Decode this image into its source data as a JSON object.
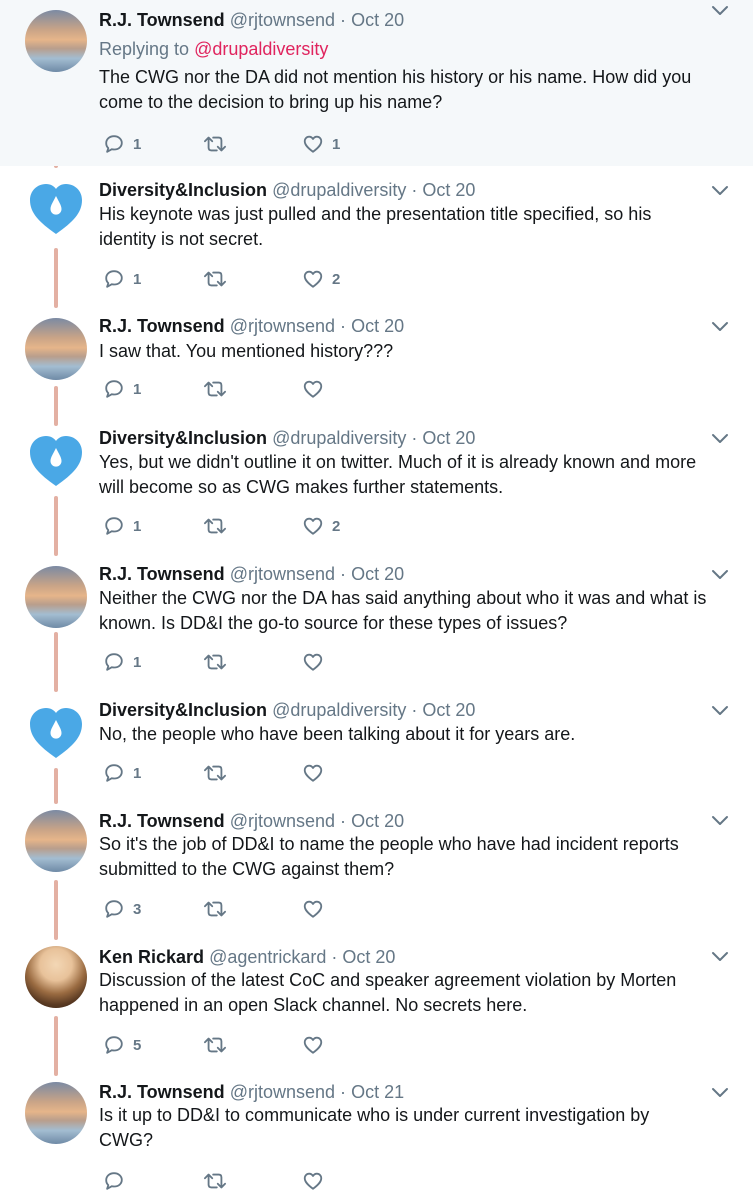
{
  "replying_to": {
    "prefix": "Replying to",
    "mention": "@drupaldiversity"
  },
  "tweets": [
    {
      "name": "R.J. Townsend",
      "handle": "@rjtownsend",
      "sep": "·",
      "time": "Oct 20",
      "lines": [
        "The CWG nor the DA did not mention his history or his name. How did you",
        "come to the decision to bring up his name?"
      ],
      "replies": "1",
      "retweets": "",
      "likes": "1"
    },
    {
      "name": "Diversity&Inclusion",
      "handle": "@drupaldiversity",
      "sep": "·",
      "time": "Oct 20",
      "lines": [
        "His keynote was just pulled and the presentation title specified, so his",
        "identity is not secret."
      ],
      "replies": "1",
      "retweets": "",
      "likes": "2"
    },
    {
      "name": "R.J. Townsend",
      "handle": "@rjtownsend",
      "sep": "·",
      "time": "Oct 20",
      "lines": [
        "I saw that. You mentioned history???"
      ],
      "replies": "1",
      "retweets": "",
      "likes": ""
    },
    {
      "name": "Diversity&Inclusion",
      "handle": "@drupaldiversity",
      "sep": "·",
      "time": "Oct 20",
      "lines": [
        "Yes, but we didn't outline it on twitter. Much of it is already known and more",
        "will become so as CWG makes further statements."
      ],
      "replies": "1",
      "retweets": "",
      "likes": "2"
    },
    {
      "name": "R.J. Townsend",
      "handle": "@rjtownsend",
      "sep": "·",
      "time": "Oct 20",
      "lines": [
        "Neither the CWG nor the DA has said anything about who it was and what is",
        "known. Is DD&I the go-to source for these types of issues?"
      ],
      "replies": "1",
      "retweets": "",
      "likes": ""
    },
    {
      "name": "Diversity&Inclusion",
      "handle": "@drupaldiversity",
      "sep": "·",
      "time": "Oct 20",
      "lines": [
        "No, the people who have been talking about it for years are."
      ],
      "replies": "1",
      "retweets": "",
      "likes": ""
    },
    {
      "name": "R.J. Townsend",
      "handle": "@rjtownsend",
      "sep": "·",
      "time": "Oct 20",
      "lines": [
        "So it's the job of DD&I to name the people who have had incident reports",
        "submitted to the CWG against them?"
      ],
      "replies": "3",
      "retweets": "",
      "likes": ""
    },
    {
      "name": "Ken Rickard",
      "handle": "@agentrickard",
      "sep": "·",
      "time": "Oct 20",
      "lines": [
        "Discussion of the latest CoC and speaker agreement violation by Morten",
        "happened in an open Slack channel.  No secrets here."
      ],
      "replies": "5",
      "retweets": "",
      "likes": ""
    },
    {
      "name": "R.J. Townsend",
      "handle": "@rjtownsend",
      "sep": "·",
      "time": "Oct 21",
      "lines": [
        "Is it up to DD&I to communicate who is under current investigation by",
        "CWG?"
      ],
      "replies": "",
      "retweets": "",
      "likes": ""
    }
  ],
  "colors": {
    "accent_reply": "#e0245e",
    "icon": "#657786",
    "thread_line": "#e3b0a3",
    "da_heart": "#4aa8e6"
  },
  "icons": {
    "reply": "reply-icon",
    "retweet": "retweet-icon",
    "like": "heart-icon",
    "more": "chevron-down-icon"
  }
}
